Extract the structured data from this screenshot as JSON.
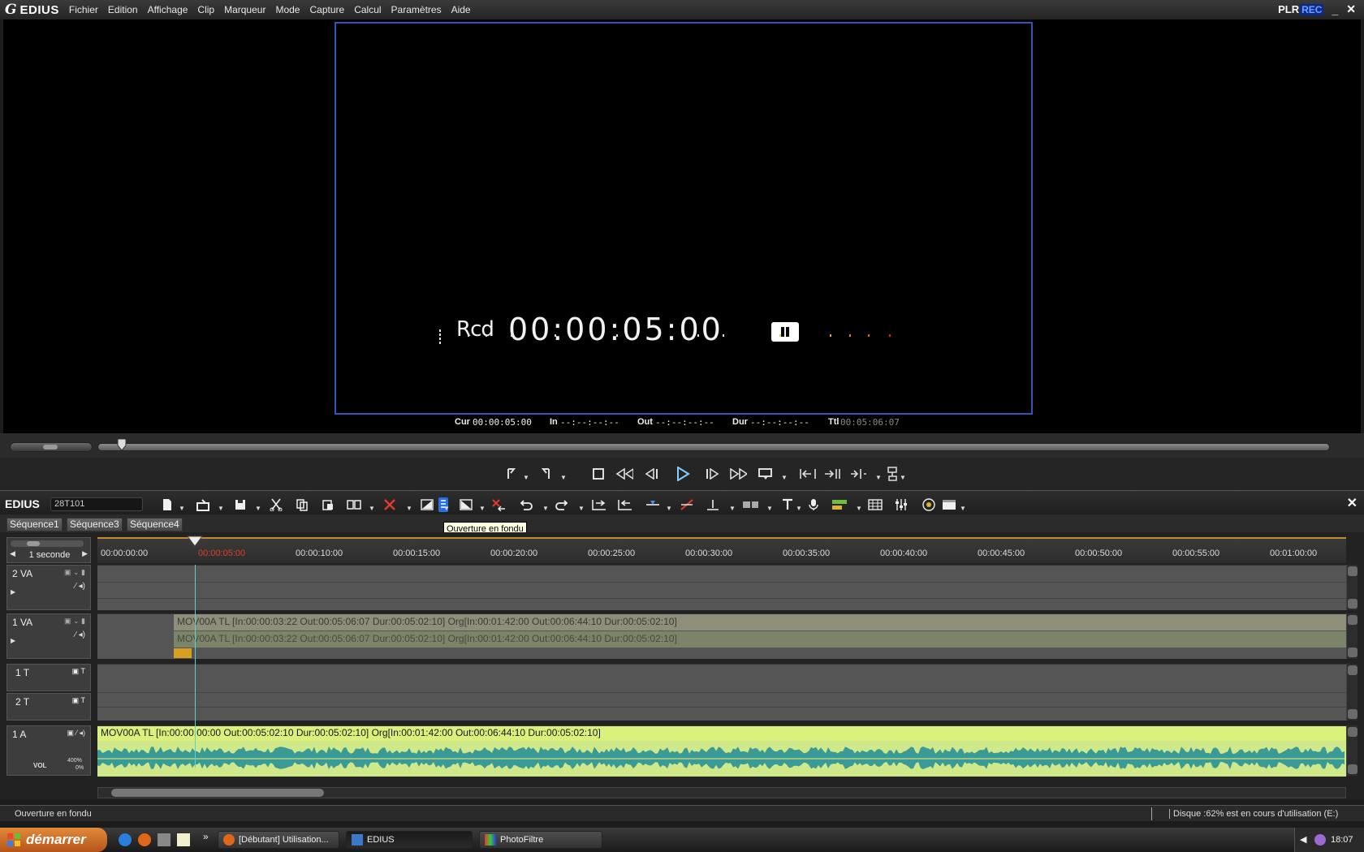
{
  "app": {
    "name": "EDIUS",
    "plr": "PLR",
    "rec": "REC",
    "minimize": "_",
    "close": "✕"
  },
  "menu": [
    "Fichier",
    "Edition",
    "Affichage",
    "Clip",
    "Marqueur",
    "Mode",
    "Capture",
    "Calcul",
    "Paramètres",
    "Aide"
  ],
  "monitor": {
    "rcd_label": "Rcd",
    "timecode": "00:00:05:00"
  },
  "tc": {
    "cur_label": "Cur",
    "cur": "00:00:05:00",
    "in_label": "In",
    "in": "--:--:--:--",
    "out_label": "Out",
    "out": "--:--:--:--",
    "dur_label": "Dur",
    "dur": "--:--:--:--",
    "ttl_label": "Ttl",
    "ttl": "00:05:06:07"
  },
  "timeline": {
    "brand": "EDIUS",
    "project": "28T101",
    "close": "✕",
    "tabs": [
      "Séquence1",
      "Séquence3",
      "Séquence4"
    ],
    "tooltip": "Ouverture en fondu",
    "scale": "1 seconde",
    "ruler": [
      "00:00:00:00",
      "00:00:05:00",
      "00:00:10:00",
      "00:00:15:00",
      "00:00:20:00",
      "00:00:25:00",
      "00:00:30:00",
      "00:00:35:00",
      "00:00:40:00",
      "00:00:45:00",
      "00:00:50:00",
      "00:00:55:00",
      "00:01:00:00"
    ],
    "tracks": {
      "va2": "2 VA",
      "va1": "1 VA",
      "t1": "1 T",
      "t2": "2 T",
      "a1": "1 A",
      "vol_label": "VOL",
      "vol_value": "400%",
      "vol_zero": "0%"
    },
    "clips": {
      "v1_upper": "MOV00A  TL [In:00:00:03:22 Out:00:05:06:07 Dur:00:05:02:10]  Org[In:00:01:42:00 Out:00:06:44:10 Dur:00:05:02:10]",
      "v1_lower": "MOV00A  TL [In:00:00:03:22 Out:00:05:06:07 Dur:00:05:02:10]  Org[In:00:01:42:00 Out:00:06:44:10 Dur:00:05:02:10]",
      "a1": "MOV00A  TL [In:00:00:00:00 Out:00:05:02:10 Dur:00:05:02:10]  Org[In:00:01:42:00 Out:00:06:44:10 Dur:00:05:02:10]"
    }
  },
  "status": {
    "left": "Ouverture en fondu",
    "right": "Disque :62% est en cours d'utilisation (E:)"
  },
  "taskbar": {
    "start": "démarrer",
    "tasks": [
      "[Débutant] Utilisation...",
      "EDIUS",
      "PhotoFiltre"
    ],
    "clock": "18:07",
    "more": "»"
  },
  "colors": {
    "accent": "#3355bb",
    "playhead": "#5fd0d0",
    "audio_clip": "#d9f07a",
    "timecode_current": "#e04020"
  }
}
